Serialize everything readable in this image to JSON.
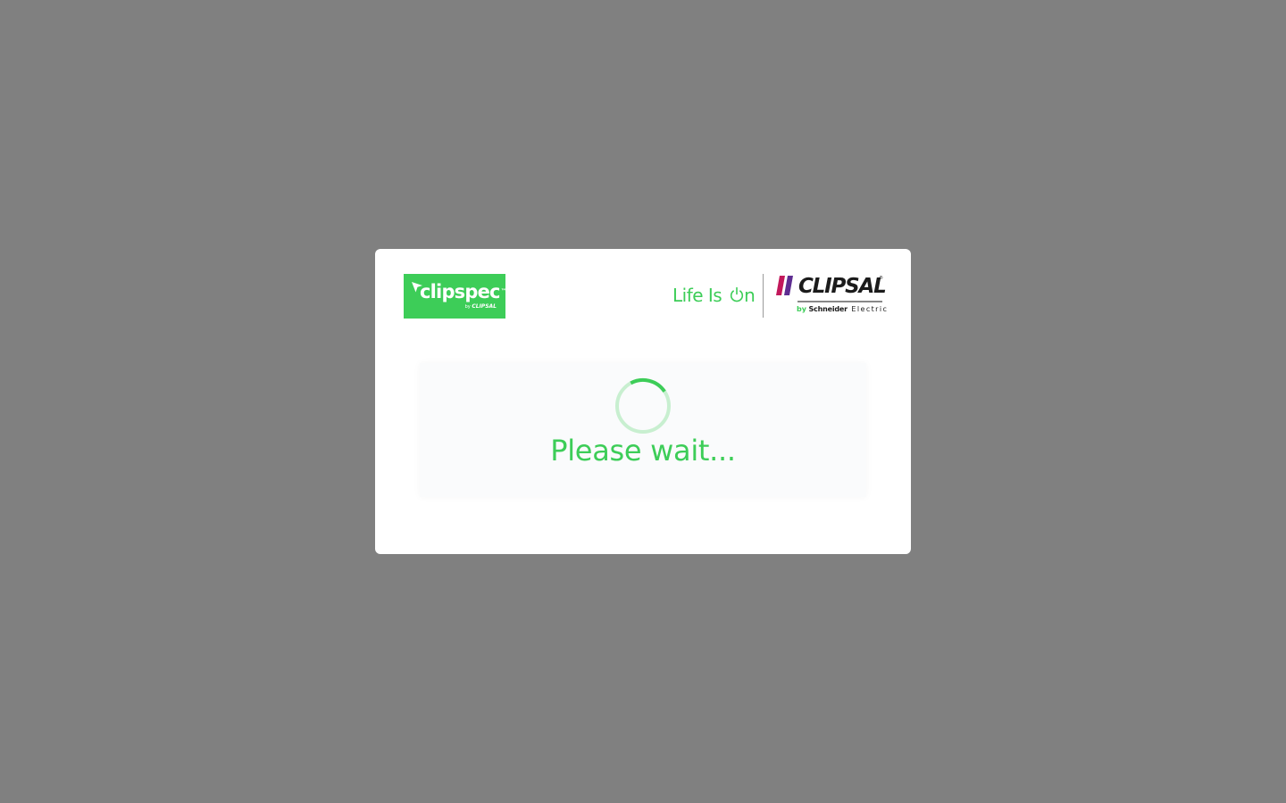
{
  "overlay": {
    "background_color": "#808080"
  },
  "dialog": {
    "brand_left": {
      "name": "clipspec",
      "trademark": "™",
      "byline_prefix": "by",
      "byline_brand": "CLIPSAL",
      "icon": "cursor-arrow-icon",
      "color": "#3dcd58"
    },
    "tagline": {
      "before_icon": "Life Is ",
      "after_icon": "n",
      "icon": "power-icon",
      "color": "#3dcd58"
    },
    "brand_right": {
      "name": "CLIPSAL",
      "registered": "®",
      "byline_by": "by",
      "byline_company": "Schneider",
      "byline_suffix": "Electric",
      "icon": "clipsal-bars-icon",
      "bar_colors": [
        "#c2185b",
        "#5e2d91"
      ]
    },
    "loading": {
      "message": "Please wait...",
      "icon": "spinner-icon",
      "accent_color": "#3dcd58",
      "track_color": "#c8efd0"
    }
  }
}
